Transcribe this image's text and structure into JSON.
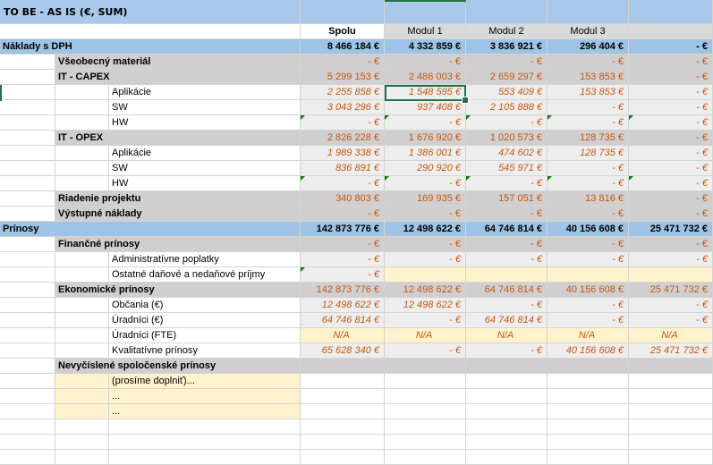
{
  "title": "TO BE - AS IS (€, SUM)",
  "columns": [
    "Spolu",
    "Modul 1",
    "Modul 2",
    "Modul 3"
  ],
  "rows": [
    {
      "label": "Náklady s DPH",
      "level": 0,
      "style": "section",
      "values": [
        "8 466 184 €",
        "4 332 859 €",
        "3 836 921 €",
        "296 404 €",
        "- €"
      ]
    },
    {
      "label": "Všeobecný materiál",
      "level": 1,
      "style": "sub",
      "values": [
        "- €",
        "- €",
        "- €",
        "- €",
        "- €"
      ]
    },
    {
      "label": "IT - CAPEX",
      "level": 1,
      "style": "sub",
      "values": [
        "5 299 153 €",
        "2 486 003 €",
        "2 659 297 €",
        "153 853 €",
        "- €"
      ]
    },
    {
      "label": "Aplikácie",
      "level": 2,
      "style": "item",
      "values": [
        "2 255 858 €",
        "1 548 595 €",
        "553 409 €",
        "153 853 €",
        "- €"
      ]
    },
    {
      "label": "SW",
      "level": 2,
      "style": "item",
      "values": [
        "3 043 296 €",
        "937 408 €",
        "2 105 888 €",
        "- €",
        "- €"
      ]
    },
    {
      "label": "HW",
      "level": 2,
      "style": "item",
      "values": [
        "- €",
        "- €",
        "- €",
        "- €",
        "- €"
      ]
    },
    {
      "label": "IT - OPEX",
      "level": 1,
      "style": "sub",
      "values": [
        "2 826 228 €",
        "1 676 920 €",
        "1 020 573 €",
        "128 735 €",
        "- €"
      ]
    },
    {
      "label": "Aplikácie",
      "level": 2,
      "style": "item",
      "values": [
        "1 989 338 €",
        "1 386 001 €",
        "474 602 €",
        "128 735 €",
        "- €"
      ]
    },
    {
      "label": "SW",
      "level": 2,
      "style": "item",
      "values": [
        "836 891 €",
        "290 920 €",
        "545 971 €",
        "- €",
        "- €"
      ]
    },
    {
      "label": "HW",
      "level": 2,
      "style": "item",
      "values": [
        "- €",
        "- €",
        "- €",
        "- €",
        "- €"
      ]
    },
    {
      "label": "Riadenie projektu",
      "level": 1,
      "style": "sub",
      "values": [
        "340 803 €",
        "169 935 €",
        "157 051 €",
        "13 816 €",
        "- €"
      ]
    },
    {
      "label": "Výstupné náklady",
      "level": 1,
      "style": "sub",
      "values": [
        "- €",
        "- €",
        "- €",
        "- €",
        "- €"
      ]
    },
    {
      "label": "Prínosy",
      "level": 0,
      "style": "section",
      "values": [
        "142 873 776 €",
        "12 498 622 €",
        "64 746 814 €",
        "40 156 608 €",
        "25 471 732 €"
      ]
    },
    {
      "label": "Finančné prínosy",
      "level": 1,
      "style": "sub",
      "values": [
        "- €",
        "- €",
        "- €",
        "- €",
        "- €"
      ]
    },
    {
      "label": "Administratívne poplatky",
      "level": 2,
      "style": "item",
      "values": [
        "- €",
        "- €",
        "- €",
        "- €",
        "- €"
      ]
    },
    {
      "label": "Ostatné daňové a nedaňové príjmy",
      "level": 2,
      "style": "item-yellow",
      "values": [
        "- €",
        "",
        "",
        "",
        ""
      ]
    },
    {
      "label": "Ekonomické prínosy",
      "level": 1,
      "style": "sub",
      "values": [
        "142 873 776 €",
        "12 498 622 €",
        "64 746 814 €",
        "40 156 608 €",
        "25 471 732 €"
      ]
    },
    {
      "label": "Občania (€)",
      "level": 2,
      "style": "item",
      "values": [
        "12 498 622 €",
        "12 498 622 €",
        "- €",
        "- €",
        "- €"
      ]
    },
    {
      "label": "Úradníci (€)",
      "level": 2,
      "style": "item",
      "values": [
        "64 746 814 €",
        "- €",
        "64 746 814 €",
        "- €",
        "- €"
      ]
    },
    {
      "label": "Úradníci (FTE)",
      "level": 2,
      "style": "item-na",
      "values": [
        "N/A",
        "N/A",
        "N/A",
        "N/A",
        "N/A"
      ]
    },
    {
      "label": "Kvalitatívne prínosy",
      "level": 2,
      "style": "item",
      "values": [
        "65 628 340 €",
        "- €",
        "- €",
        "40 156 608 €",
        "25 471 732 €"
      ]
    },
    {
      "label": "Nevyčíslené spoločenské prínosy",
      "level": 1,
      "style": "sub",
      "values": [
        "",
        "",
        "",
        "",
        ""
      ]
    },
    {
      "label": "(prosíme doplniť)...",
      "level": 2,
      "style": "fill",
      "values": [
        "",
        "",
        "",
        "",
        ""
      ]
    },
    {
      "label": "...",
      "level": 2,
      "style": "fill",
      "values": [
        "",
        "",
        "",
        "",
        ""
      ]
    },
    {
      "label": "...",
      "level": 2,
      "style": "fill",
      "values": [
        "",
        "",
        "",
        "",
        ""
      ]
    }
  ],
  "selected_cell": "1 548 595 €",
  "colors": {
    "section": "#9dc3e6",
    "sub": "#d0cece",
    "item": "#ededed",
    "fill": "#fff2cc",
    "value_text": "#c65911",
    "selection": "#217346"
  }
}
